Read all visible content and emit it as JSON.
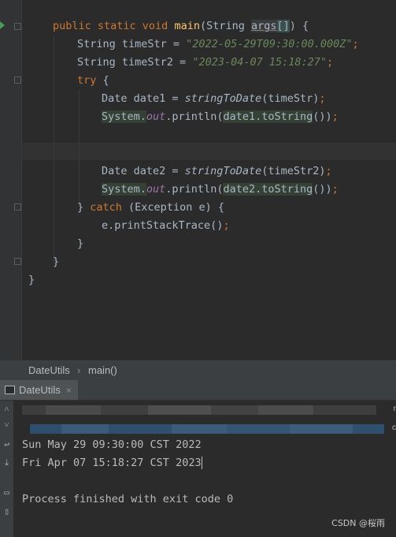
{
  "editor": {
    "lines": [
      {
        "id": "l1",
        "parts": [
          {
            "t": "public static void ",
            "c": "kw"
          },
          {
            "t": "main",
            "c": "fn"
          },
          {
            "t": "(String ",
            "c": ""
          },
          {
            "t": "args",
            "c": "param-hl"
          },
          {
            "t": "[]",
            "c": "bracket-hl"
          },
          {
            "t": ") {",
            "c": ""
          }
        ]
      },
      {
        "id": "l2",
        "parts": [
          {
            "t": "String timeStr = ",
            "c": ""
          },
          {
            "t": "\"2022-05-29T09:30:00.000Z\"",
            "c": "str"
          },
          {
            "t": ";",
            "c": "kw"
          }
        ]
      },
      {
        "id": "l3",
        "parts": [
          {
            "t": "String timeStr2 = ",
            "c": ""
          },
          {
            "t": "\"2023-04-07 15:18:27\"",
            "c": "str"
          },
          {
            "t": ";",
            "c": "kw"
          }
        ]
      },
      {
        "id": "l4",
        "parts": [
          {
            "t": "try ",
            "c": "kw"
          },
          {
            "t": "{",
            "c": ""
          }
        ]
      },
      {
        "id": "l5",
        "parts": [
          {
            "t": "Date date1 = ",
            "c": ""
          },
          {
            "t": "stringToDate",
            "c": "italic"
          },
          {
            "t": "(timeStr)",
            "c": ""
          },
          {
            "t": ";",
            "c": "kw"
          }
        ]
      },
      {
        "id": "l6",
        "parts": [
          {
            "t": "System.",
            "c": "method-bg"
          },
          {
            "t": "out",
            "c": "field"
          },
          {
            "t": ".println(",
            "c": ""
          },
          {
            "t": "date1.toString",
            "c": "method-bg"
          },
          {
            "t": "())",
            "c": ""
          },
          {
            "t": ";",
            "c": "kw"
          }
        ]
      },
      {
        "id": "l7",
        "parts": []
      },
      {
        "id": "l8",
        "parts": []
      },
      {
        "id": "l9",
        "parts": [
          {
            "t": "Date date2 = ",
            "c": ""
          },
          {
            "t": "stringToDate",
            "c": "italic"
          },
          {
            "t": "(timeStr2)",
            "c": ""
          },
          {
            "t": ";",
            "c": "kw"
          }
        ]
      },
      {
        "id": "l10",
        "parts": [
          {
            "t": "System.",
            "c": "method-bg"
          },
          {
            "t": "out",
            "c": "field"
          },
          {
            "t": ".println(",
            "c": ""
          },
          {
            "t": "date2.toString",
            "c": "method-bg"
          },
          {
            "t": "())",
            "c": ""
          },
          {
            "t": ";",
            "c": "kw"
          }
        ]
      },
      {
        "id": "l11",
        "parts": [
          {
            "t": "} ",
            "c": ""
          },
          {
            "t": "catch ",
            "c": "kw"
          },
          {
            "t": "(Exception e) {",
            "c": ""
          }
        ]
      },
      {
        "id": "l12",
        "parts": [
          {
            "t": "e.printStackTrace()",
            "c": ""
          },
          {
            "t": ";",
            "c": "kw"
          }
        ]
      },
      {
        "id": "l13",
        "parts": [
          {
            "t": "}",
            "c": ""
          }
        ]
      },
      {
        "id": "l14",
        "parts": [
          {
            "t": "}",
            "c": ""
          }
        ]
      },
      {
        "id": "l15",
        "parts": [
          {
            "t": "}",
            "c": ""
          }
        ]
      }
    ]
  },
  "breadcrumb": {
    "class_name": "DateUtils",
    "separator": "›",
    "method_name": "main()"
  },
  "run_panel": {
    "tab_label": "DateUtils",
    "tab_close": "×",
    "output": [
      "Sun May 29 09:30:00 CST 2022",
      "Fri Apr 07 15:18:27 CST 2023",
      "",
      "Process finished with exit code 0"
    ],
    "toolbar_icons": [
      "up-arrow-icon",
      "down-arrow-icon",
      "wrap-icon",
      "scroll-end-icon",
      "print-icon",
      "delete-icon"
    ]
  },
  "watermark": "CSDN @桜雨"
}
